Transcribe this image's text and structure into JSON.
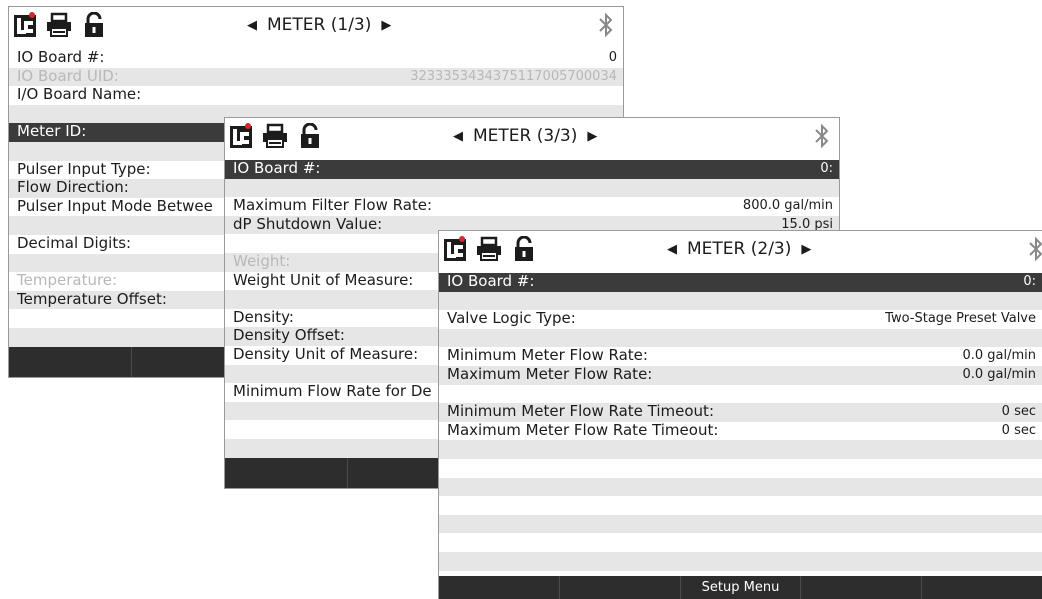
{
  "window1": {
    "title": "METER (1/3)",
    "rows": [
      {
        "label": "IO Board #:",
        "value": "0"
      },
      {
        "label": "IO Board UID:",
        "value": "3233353434375117005700034"
      },
      {
        "label": "I/O Board Name:",
        "value": ""
      },
      {
        "label": "",
        "value": ""
      },
      {
        "label": "Meter ID:",
        "value": ""
      },
      {
        "label": "",
        "value": ""
      },
      {
        "label": "Pulser Input Type:",
        "value": ""
      },
      {
        "label": "Flow Direction:",
        "value": ""
      },
      {
        "label": "Pulser Input Mode Betwee",
        "value": ""
      },
      {
        "label": "",
        "value": ""
      },
      {
        "label": "Decimal Digits:",
        "value": ""
      },
      {
        "label": "",
        "value": ""
      },
      {
        "label": "Temperature:",
        "value": ""
      },
      {
        "label": "Temperature Offset:",
        "value": ""
      }
    ]
  },
  "window3": {
    "title": "METER (3/3)",
    "rows": [
      {
        "label": "IO Board #:",
        "value": "0:"
      },
      {
        "label": "",
        "value": ""
      },
      {
        "label": "Maximum Filter Flow Rate:",
        "value": "800.0 gal/min"
      },
      {
        "label": "dP Shutdown Value:",
        "value": "15.0 psi"
      },
      {
        "label": "",
        "value": ""
      },
      {
        "label": "Weight:",
        "value": ""
      },
      {
        "label": "Weight Unit of Measure:",
        "value": ""
      },
      {
        "label": "",
        "value": ""
      },
      {
        "label": "Density:",
        "value": ""
      },
      {
        "label": "Density Offset:",
        "value": ""
      },
      {
        "label": "Density Unit of Measure:",
        "value": ""
      },
      {
        "label": "",
        "value": ""
      },
      {
        "label": "Minimum Flow Rate for De",
        "value": ""
      }
    ]
  },
  "window2": {
    "title": "METER (2/3)",
    "rows": [
      {
        "label": "IO Board #:",
        "value": "0:"
      },
      {
        "label": "",
        "value": ""
      },
      {
        "label": "Valve Logic Type:",
        "value": "Two-Stage Preset Valve"
      },
      {
        "label": "",
        "value": ""
      },
      {
        "label": "Minimum Meter Flow Rate:",
        "value": "0.0 gal/min"
      },
      {
        "label": "Maximum Meter Flow Rate:",
        "value": "0.0 gal/min"
      },
      {
        "label": "",
        "value": ""
      },
      {
        "label": "Minimum Meter Flow Rate Timeout:",
        "value": "0 sec"
      },
      {
        "label": "Maximum Meter Flow Rate Timeout:",
        "value": "0 sec"
      }
    ],
    "footer": [
      "",
      "",
      "Setup Menu",
      "",
      ""
    ]
  },
  "icons": [
    "lc-logo-icon",
    "printer-icon",
    "unlock-icon",
    "bluetooth-icon",
    "left-arrow-icon",
    "right-arrow-icon"
  ],
  "colors": {
    "selected_row": "#3b3b3b",
    "alt_row": "#e6e6e6",
    "footer": "#2d2d2d",
    "logo_red": "#d9262c"
  }
}
